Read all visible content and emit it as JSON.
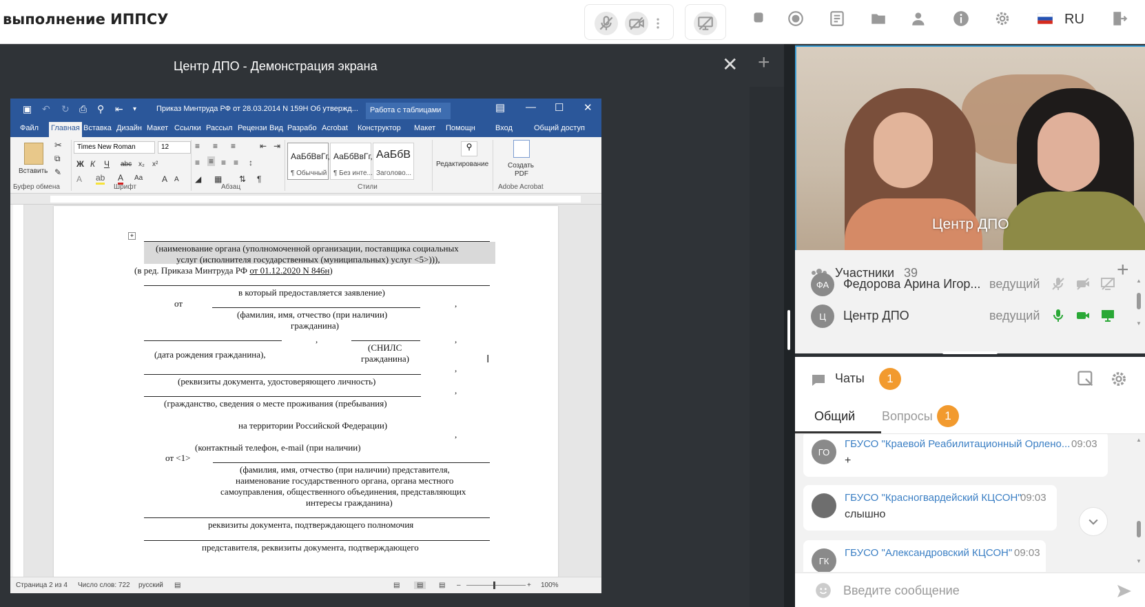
{
  "topbar": {
    "title": "выполнение ИППСУ",
    "language": "RU",
    "icons": [
      "mic-off-icon",
      "camera-off-icon",
      "more-icon",
      "screen-share-off-icon",
      "stop-icon",
      "record-icon",
      "notes-icon",
      "folder-icon",
      "add-user-icon",
      "info-icon",
      "settings-icon",
      "flag-ru-icon",
      "exit-icon"
    ]
  },
  "share": {
    "title": "Центр ДПО - Демонстрация экрана"
  },
  "word": {
    "doc_title": "Приказ Минтруда РФ от 28.03.2014 N 159Н Об утвержд...",
    "table_tools": "Работа с таблицами",
    "tabs": [
      "Файл",
      "Главная",
      "Вставка",
      "Дизайн",
      "Макет",
      "Ссылки",
      "Рассыл",
      "Рецензи",
      "Вид",
      "Разрабо",
      "Acrobat",
      "Конструктор",
      "Макет",
      "Помощн",
      "Вход",
      "Общий доступ"
    ],
    "font_name": "Times New Roman",
    "font_size": "12",
    "paste_label": "Вставить",
    "groups": [
      "Буфер обмена",
      "Шрифт",
      "Абзац",
      "Стили",
      "Adobe Acrobat"
    ],
    "styles": [
      {
        "sample": "АаБбВвГг,",
        "name": "¶ Обычный"
      },
      {
        "sample": "АаБбВвГг,",
        "name": "¶ Без инте..."
      },
      {
        "sample": "АаБбВ",
        "name": "Заголово..."
      }
    ],
    "editing_label": "Редактирование",
    "pdf_label_1": "Создать",
    "pdf_label_2": "PDF",
    "doc_lines": {
      "l1": "(наименование органа (уполномоченной организации, поставщика социальных",
      "l2": "услуг (исполнителя государственных (муниципальных) услуг <5>))),",
      "l3a": "(в ред. Приказа Минтруда РФ ",
      "l3b": "от 01.12.2020 N 846н",
      "l3c": ")",
      "l4": "в который предоставляется заявление)",
      "l5": "от",
      "l6": "(фамилия, имя, отчество (при наличии)",
      "l7": "гражданина)",
      "l8": "(дата рождения гражданина),",
      "l9a": "(СНИЛС",
      "l9b": "гражданина)",
      "l10": "(реквизиты документа, удостоверяющего личность)",
      "l11": "(гражданство, сведения о месте проживания (пребывания)",
      "l12": "на территории Российской Федерации)",
      "l13": "(контактный телефон, e-mail (при наличии)",
      "l14": "от <1>",
      "l15": "(фамилия, имя, отчество (при наличии) представителя,",
      "l16": "наименование государственного органа, органа местного",
      "l17": "самоуправления, общественного объединения, представляющих",
      "l18": "интересы гражданина)",
      "l19": "реквизиты документа, подтверждающего полномочия",
      "l20": "представителя, реквизиты документа, подтверждающего",
      "comma": ","
    },
    "status": {
      "page": "Страница 2 из 4",
      "words": "Число слов: 722",
      "lang": "русский",
      "zoom": "100%"
    }
  },
  "video": {
    "name": "Центр ДПО"
  },
  "participants": {
    "label": "Участники",
    "count": "39",
    "rows": [
      {
        "initials": "ФА",
        "name": "Федорова Арина Игор...",
        "role": "ведущий"
      },
      {
        "initials": "Ц",
        "name": "Центр ДПО",
        "role": "ведущий"
      }
    ]
  },
  "chat": {
    "label": "Чаты",
    "badge": "1",
    "tabs": [
      {
        "label": "Общий"
      },
      {
        "label": "Вопросы",
        "badge": "1"
      }
    ],
    "messages": [
      {
        "initials": "ГО",
        "who": "ГБУСО \"Краевой Реабилитационный Орлено...",
        "time": "09:03",
        "text": "+"
      },
      {
        "initials": "",
        "who": "ГБУСО \"Красногвардейский КЦСОН\"",
        "time": "09:03",
        "text": "слышно"
      },
      {
        "initials": "ГК",
        "who": "ГБУСО \"Александровский КЦСОН\"",
        "time": "09:03",
        "text": ""
      }
    ],
    "placeholder": "Введите сообщение"
  },
  "colors": {
    "word_blue": "#2b579a",
    "accent_orange": "#f29a2e",
    "link_blue": "#3b7fc4",
    "live_green": "#2aa836"
  }
}
